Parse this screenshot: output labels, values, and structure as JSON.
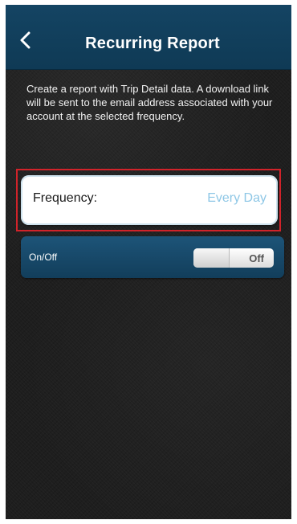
{
  "nav": {
    "back_icon": "chevron-left-icon",
    "title": "Recurring Report"
  },
  "description": "Create a report with Trip Detail data. A download link will be sent to the email address associated with your account at the selected frequency.",
  "frequency": {
    "label": "Frequency:",
    "value": "Every Day"
  },
  "toggle_row": {
    "label": "On/Off",
    "state_label": "Off"
  },
  "colors": {
    "navbar": "#144463",
    "accent_value": "#8ec7e6",
    "highlight_border": "#d1232a",
    "row_blue": "#1d5478"
  }
}
